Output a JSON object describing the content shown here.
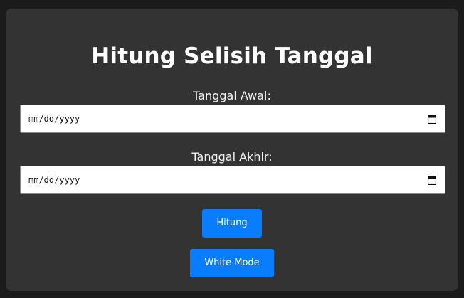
{
  "page": {
    "title": "Hitung Selisih Tanggal"
  },
  "form": {
    "start_label": "Tanggal Awal:",
    "start_placeholder": "mm/dd/yyyy",
    "end_label": "Tanggal Akhir:",
    "end_placeholder": "mm/dd/yyyy",
    "calendar_icon": "calendar-icon"
  },
  "buttons": {
    "calculate_label": "Hitung",
    "mode_label": "White Mode"
  },
  "colors": {
    "background": "#1b1b1b",
    "card": "#333333",
    "accent": "#0a7cff",
    "text": "#ffffff"
  }
}
